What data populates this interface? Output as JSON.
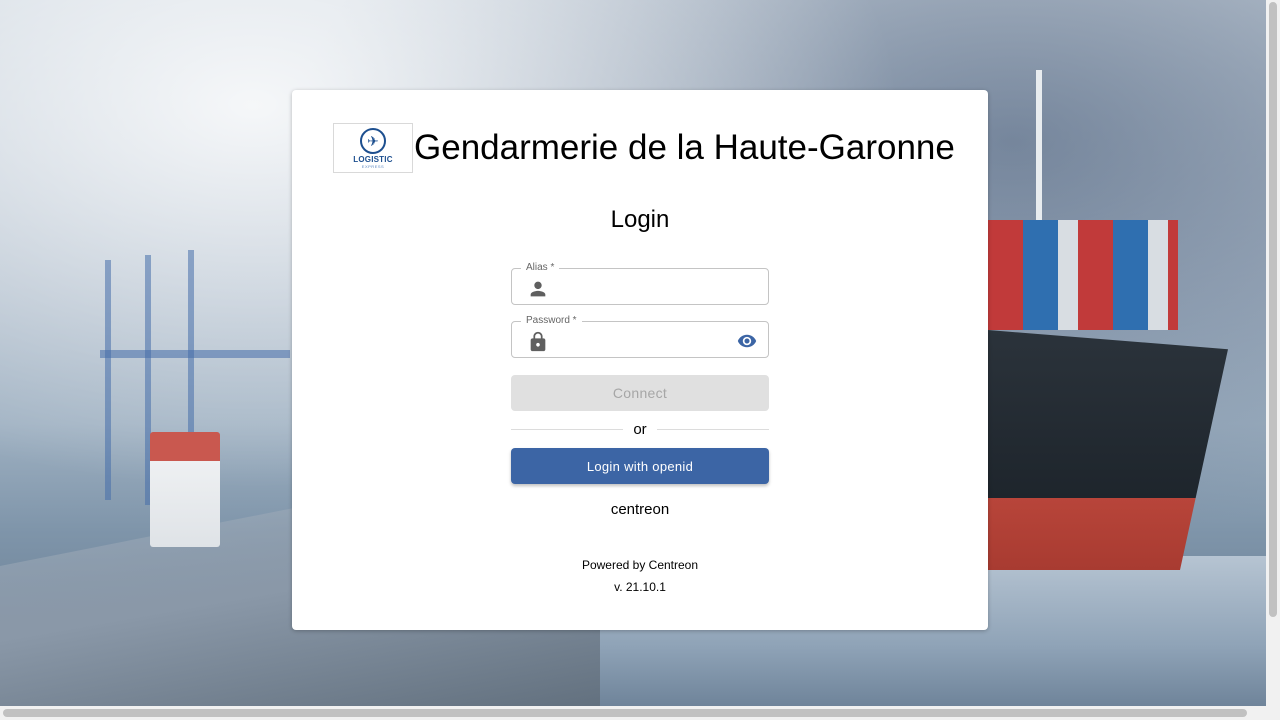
{
  "platform": {
    "name": "Gendarmerie de la Haute-Garonne",
    "logo": {
      "name": "LOGISTIC",
      "subtitle": "EXPRESS"
    }
  },
  "login": {
    "title": "Login",
    "alias": {
      "label": "Alias *",
      "value": "",
      "icon": "person-icon"
    },
    "password": {
      "label": "Password *",
      "value": "",
      "icon": "lock-icon",
      "toggle_icon": "eye-icon"
    },
    "connect_label": "Connect",
    "divider_text": "or",
    "openid_label": "Login with openid",
    "provider_name": "centreon"
  },
  "footer": {
    "powered_by": "Powered by Centreon",
    "version": "v. 21.10.1"
  },
  "colors": {
    "primary": "#3c65a5",
    "disabled_bg": "#e0e0e0",
    "disabled_text": "#a6a6a6",
    "icon": "#5f5f5f"
  }
}
